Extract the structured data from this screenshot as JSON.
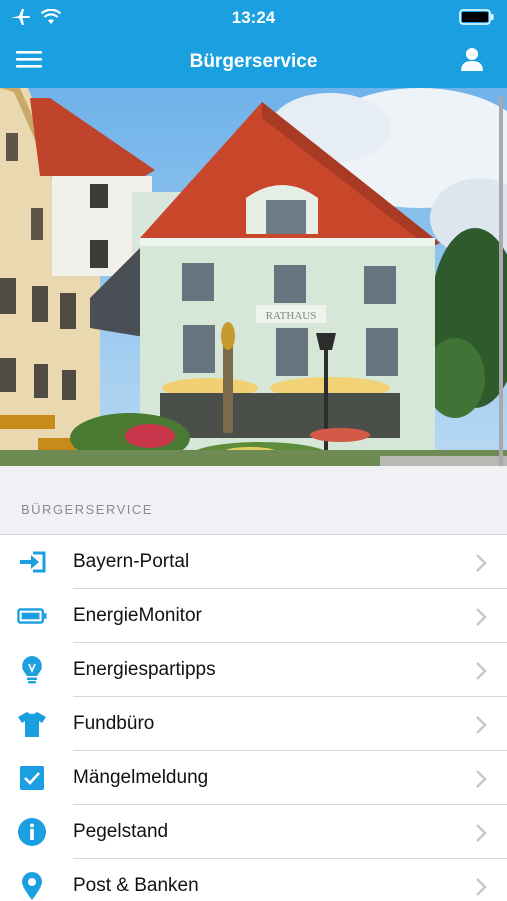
{
  "status": {
    "time": "13:24"
  },
  "nav": {
    "title": "Bürgerservice"
  },
  "hero": {
    "building_sign": "RATHAUS"
  },
  "section": {
    "title": "BÜRGERSERVICE"
  },
  "list": {
    "items": [
      {
        "label": "Bayern-Portal",
        "icon": "login-arrow-icon"
      },
      {
        "label": "EnergieMonitor",
        "icon": "battery-meter-icon"
      },
      {
        "label": "Energiespartipps",
        "icon": "lightbulb-icon"
      },
      {
        "label": "Fundbüro",
        "icon": "tshirt-icon"
      },
      {
        "label": "Mängelmeldung",
        "icon": "checkbox-icon"
      },
      {
        "label": "Pegelstand",
        "icon": "info-icon"
      },
      {
        "label": "Post & Banken",
        "icon": "location-pin-icon"
      }
    ]
  },
  "colors": {
    "accent": "#1a9fe0",
    "icon": "#1a9fe0"
  }
}
